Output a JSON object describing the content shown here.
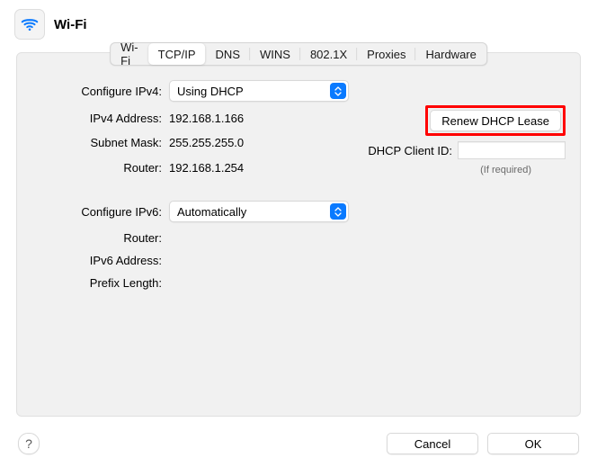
{
  "header": {
    "title": "Wi-Fi",
    "icon": "wifi-icon"
  },
  "tabs": {
    "wifi": "Wi-Fi",
    "tcpip": "TCP/IP",
    "dns": "DNS",
    "wins": "WINS",
    "8021x": "802.1X",
    "proxies": "Proxies",
    "hardware": "Hardware",
    "active": "tcpip"
  },
  "ipv4": {
    "configure_label": "Configure IPv4:",
    "configure_value": "Using DHCP",
    "address_label": "IPv4 Address:",
    "address_value": "192.168.1.166",
    "subnet_label": "Subnet Mask:",
    "subnet_value": "255.255.255.0",
    "router_label": "Router:",
    "router_value": "192.168.1.254"
  },
  "dhcp": {
    "renew_button": "Renew DHCP Lease",
    "client_id_label": "DHCP Client ID:",
    "client_id_value": "",
    "note": "(If required)"
  },
  "ipv6": {
    "configure_label": "Configure IPv6:",
    "configure_value": "Automatically",
    "router_label": "Router:",
    "router_value": "",
    "address_label": "IPv6 Address:",
    "address_value": "",
    "prefix_label": "Prefix Length:",
    "prefix_value": ""
  },
  "footer": {
    "help": "?",
    "cancel": "Cancel",
    "ok": "OK"
  }
}
